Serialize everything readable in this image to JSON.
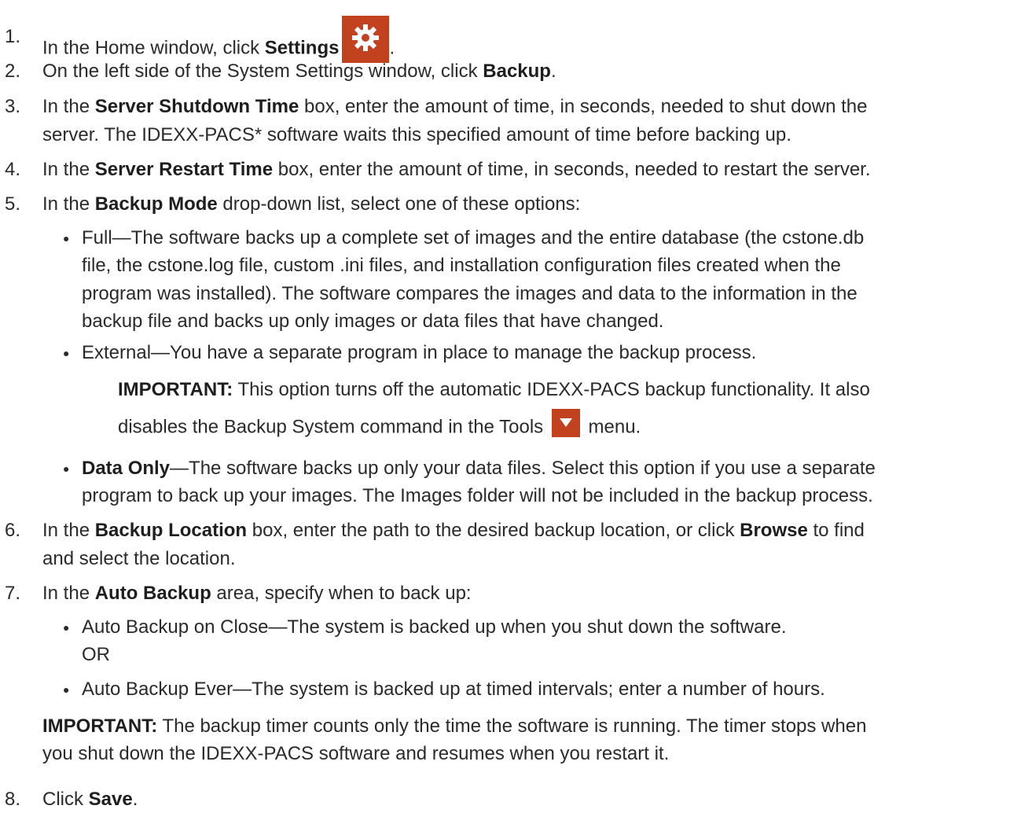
{
  "steps": [
    {
      "num": "1.",
      "pre": "In the Home window, click ",
      "bold": "Settings",
      "post": "."
    },
    {
      "num": "2.",
      "pre": "On the left side of the System Settings window, click ",
      "bold": "Backup",
      "post": "."
    },
    {
      "num": "3.",
      "pre": "In the ",
      "bold": "Server Shutdown Time",
      "post": " box, enter the amount of time, in seconds, needed to shut down the",
      "line2": "server. The IDEXX-PACS* software waits this specified amount of time before backing up."
    },
    {
      "num": "4.",
      "pre": "In the ",
      "bold": "Server Restart Time",
      "post": " box, enter the amount of time, in seconds, needed to restart the server."
    },
    {
      "num": "5.",
      "pre": "In the ",
      "bold": "Backup Mode",
      "post": " drop-down list, select one of these options:"
    },
    {
      "num": "6.",
      "pre": "In the ",
      "bold": "Backup Location",
      "post": " box, enter the path to the desired backup location, or click ",
      "bold2": "Browse",
      "post2": " to find",
      "line2": "and select the location."
    },
    {
      "num": "7.",
      "pre": "In the ",
      "bold": "Auto Backup",
      "post": " area, specify when to back up:"
    },
    {
      "num": "8.",
      "pre": "Click ",
      "bold": "Save",
      "post": "."
    }
  ],
  "mode_options": {
    "full_l1": "Full—The software backs up a complete set of images and the entire database (the cstone.db",
    "full_l2": "file, the cstone.log file, custom .ini files, and installation configuration files created when the",
    "full_l3": "program was installed). The software compares the images and data to the information in the",
    "full_l4": "backup file and backs up only images or data files that have changed.",
    "external": "External—You have a separate program in place to manage the backup process.",
    "ext_imp_label": "IMPORTANT:",
    "ext_imp_l1": " This option turns off the automatic IDEXX-PACS backup functionality. It also",
    "ext_imp_l2_pre": "disables the Backup System command in the Tools ",
    "ext_imp_l2_post": " menu.",
    "data_only_bold": "Data Only",
    "data_only_l1": "—The software backs up only your data files. Select this option if you use a separate",
    "data_only_l2": "program to back up your images. The Images folder will not be included in the backup process."
  },
  "auto_options": {
    "on_close": "Auto Backup on Close—The system is backed up when you shut down the software.",
    "or": "OR",
    "every": "Auto Backup Ever—The system is backed up at timed intervals; enter a number of hours.",
    "imp_label": "IMPORTANT:",
    "imp_l1": " The backup timer counts only the time the software is running. The timer stops when",
    "imp_l2": "you shut down the IDEXX-PACS software and resumes when you restart it."
  },
  "icons": {
    "settings": "gear-icon",
    "tools_menu": "chevron-down-icon"
  },
  "colors": {
    "icon_bg": "#c2411f",
    "text": "#2a2a2a"
  }
}
